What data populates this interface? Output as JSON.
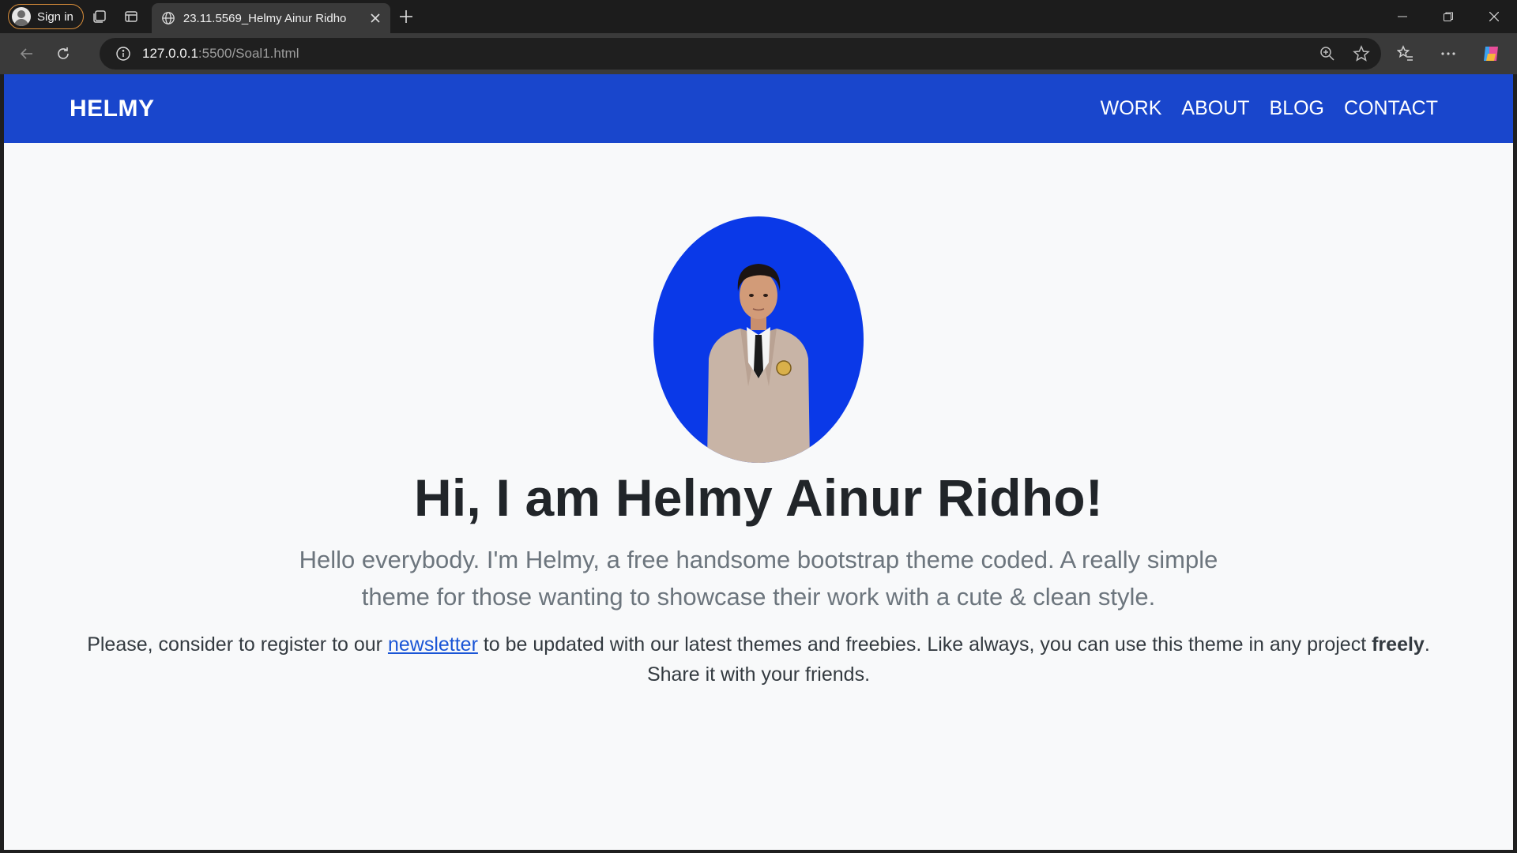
{
  "browser": {
    "signin_label": "Sign in",
    "tab_title": "23.11.5569_Helmy Ainur Ridho",
    "url_host": "127.0.0.1",
    "url_path": ":5500/Soal1.html"
  },
  "site": {
    "brand": "HELMY",
    "nav": [
      "WORK",
      "ABOUT",
      "BLOG",
      "CONTACT"
    ],
    "accent_color": "#1946cc"
  },
  "hero": {
    "heading": "Hi, I am Helmy Ainur Ridho!",
    "lead": "Hello everybody. I'm Helmy, a free handsome bootstrap theme coded. A really simple theme for those wanting to showcase their work with a cute & clean style.",
    "body_before": "Please, consider to register to our ",
    "body_link": "newsletter",
    "body_middle": " to be updated with our latest themes and freebies. Like always, you can use this theme in any project ",
    "body_bold": "freely",
    "body_after": ". Share it with your friends."
  }
}
